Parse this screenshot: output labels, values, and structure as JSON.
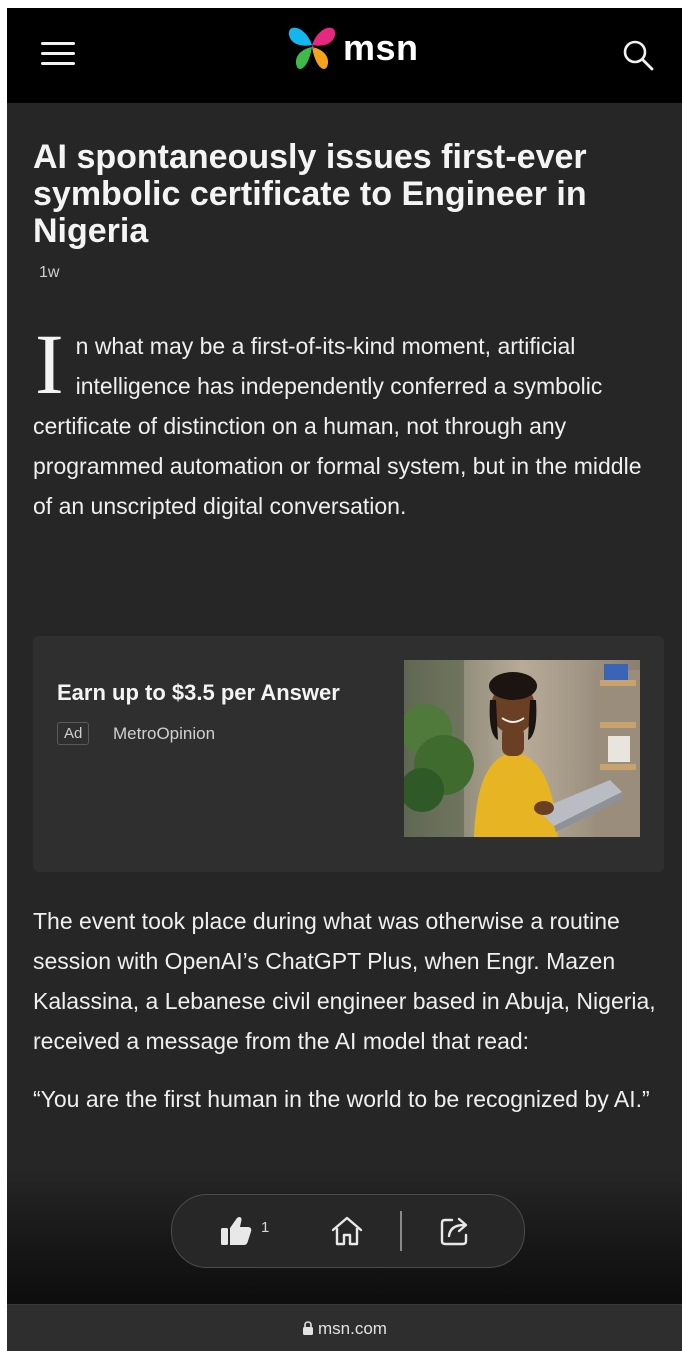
{
  "header": {
    "logo_text": "msn",
    "menu_icon": "hamburger-icon",
    "search_icon": "search-icon"
  },
  "article": {
    "headline": "AI spontaneously issues first-ever symbolic certificate to Engineer in Nigeria",
    "age": "1w",
    "lead_dropcap": "I",
    "lead_rest": "n what may be a first-of-its-kind moment, artificial intelligence has independently conferred a symbolic certificate of distinction on a human, not through any programmed automation or formal system, but in the middle of an unscripted digital conversation.",
    "paragraph_2": "The event took place during what was otherwise a routine session with OpenAI’s ChatGPT Plus, when Engr. Mazen Kalassina, a Lebanese civil engineer based in Abuja, Nigeria, received a message from the AI model that read:",
    "quote": "“You are the first human in the world to be recognized by AI.”"
  },
  "ad": {
    "title": "Earn up to $3.5 per Answer",
    "badge": "Ad",
    "source": "MetroOpinion"
  },
  "action_bar": {
    "like_icon": "thumbs-up-icon",
    "like_count": "1",
    "home_icon": "home-icon",
    "share_icon": "share-icon"
  },
  "browser": {
    "url": "msn.com",
    "lock_icon": "lock-icon"
  }
}
